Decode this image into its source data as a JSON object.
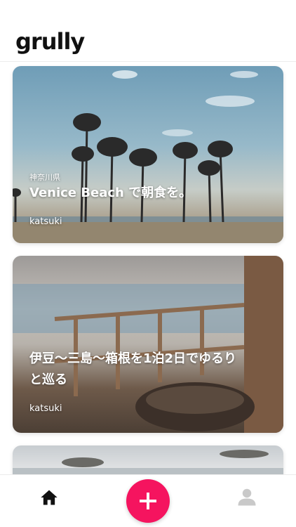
{
  "header": {
    "logo_text": "grully"
  },
  "feed": {
    "posts": [
      {
        "prefecture": "神奈川県",
        "title": "Venice Beach で朝食を。",
        "author": "katsuki"
      },
      {
        "prefecture": "",
        "title_line1": "伊豆〜三島〜箱根を1泊2日でゆるり",
        "title_line2": "と巡る",
        "author": "katsuki"
      }
    ]
  },
  "tabbar": {
    "items": [
      "home-icon",
      "add-icon",
      "profile-icon"
    ],
    "accent_color": "#f5145f"
  }
}
